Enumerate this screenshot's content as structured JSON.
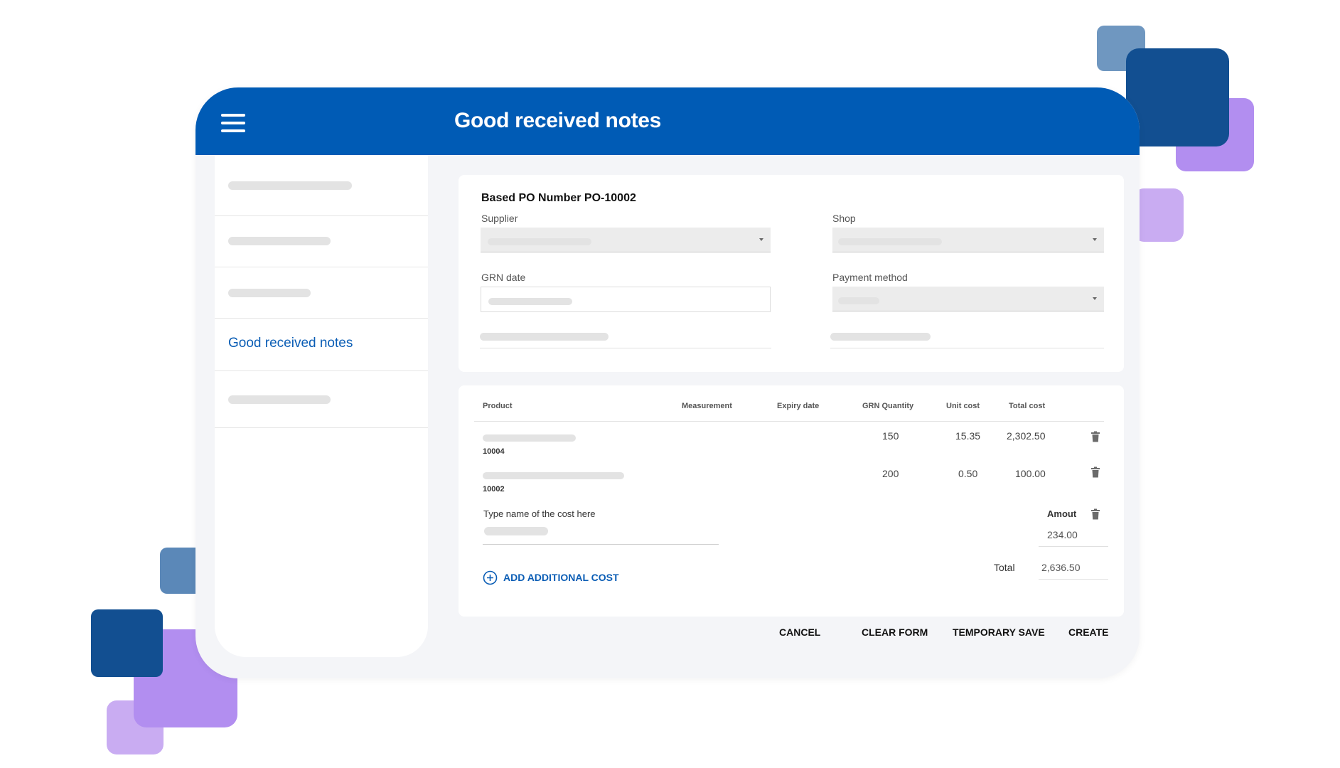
{
  "header": {
    "title": "Good received notes"
  },
  "sidebar": {
    "items": [
      {
        "label": ""
      },
      {
        "label": ""
      },
      {
        "label": ""
      },
      {
        "label": "Good received notes",
        "active": true
      },
      {
        "label": ""
      }
    ]
  },
  "form": {
    "po_title": "Based PO Number PO-10002",
    "supplier_label": "Supplier",
    "shop_label": "Shop",
    "grn_date_label": "GRN date",
    "payment_method_label": "Payment method"
  },
  "table": {
    "columns": [
      "Product",
      "Measurement",
      "Expiry date",
      "GRN Quantity",
      "Unit cost",
      "Total cost"
    ],
    "rows": [
      {
        "product_code": "10004",
        "measurement": "",
        "expiry_date": "",
        "grn_quantity": "150",
        "unit_cost": "15.35",
        "total_cost": "2,302.50"
      },
      {
        "product_code": "10002",
        "measurement": "",
        "expiry_date": "",
        "grn_quantity": "200",
        "unit_cost": "0.50",
        "total_cost": "100.00"
      }
    ]
  },
  "additional_cost": {
    "name_label": "Type name of the cost here",
    "amount_label": "Amout",
    "amount_value": "234.00",
    "add_label": "ADD ADDITIONAL COST"
  },
  "totals": {
    "label": "Total",
    "value": "2,636.50"
  },
  "actions": {
    "cancel": "CANCEL",
    "clear_form": "CLEAR FORM",
    "temporary_save": "TEMPORARY SAVE",
    "create": "CREATE"
  },
  "icons": {
    "menu": "hamburger-menu-icon",
    "delete": "trash-icon",
    "add": "plus-circle-icon"
  },
  "colors": {
    "brand_blue": "#005bb5",
    "link_blue": "#0a5db5",
    "deco_light_purple": "#c9acf2",
    "deco_purple": "#b28ef0",
    "deco_dark_blue": "#124f91",
    "deco_mid_blue": "#5b88b8"
  }
}
